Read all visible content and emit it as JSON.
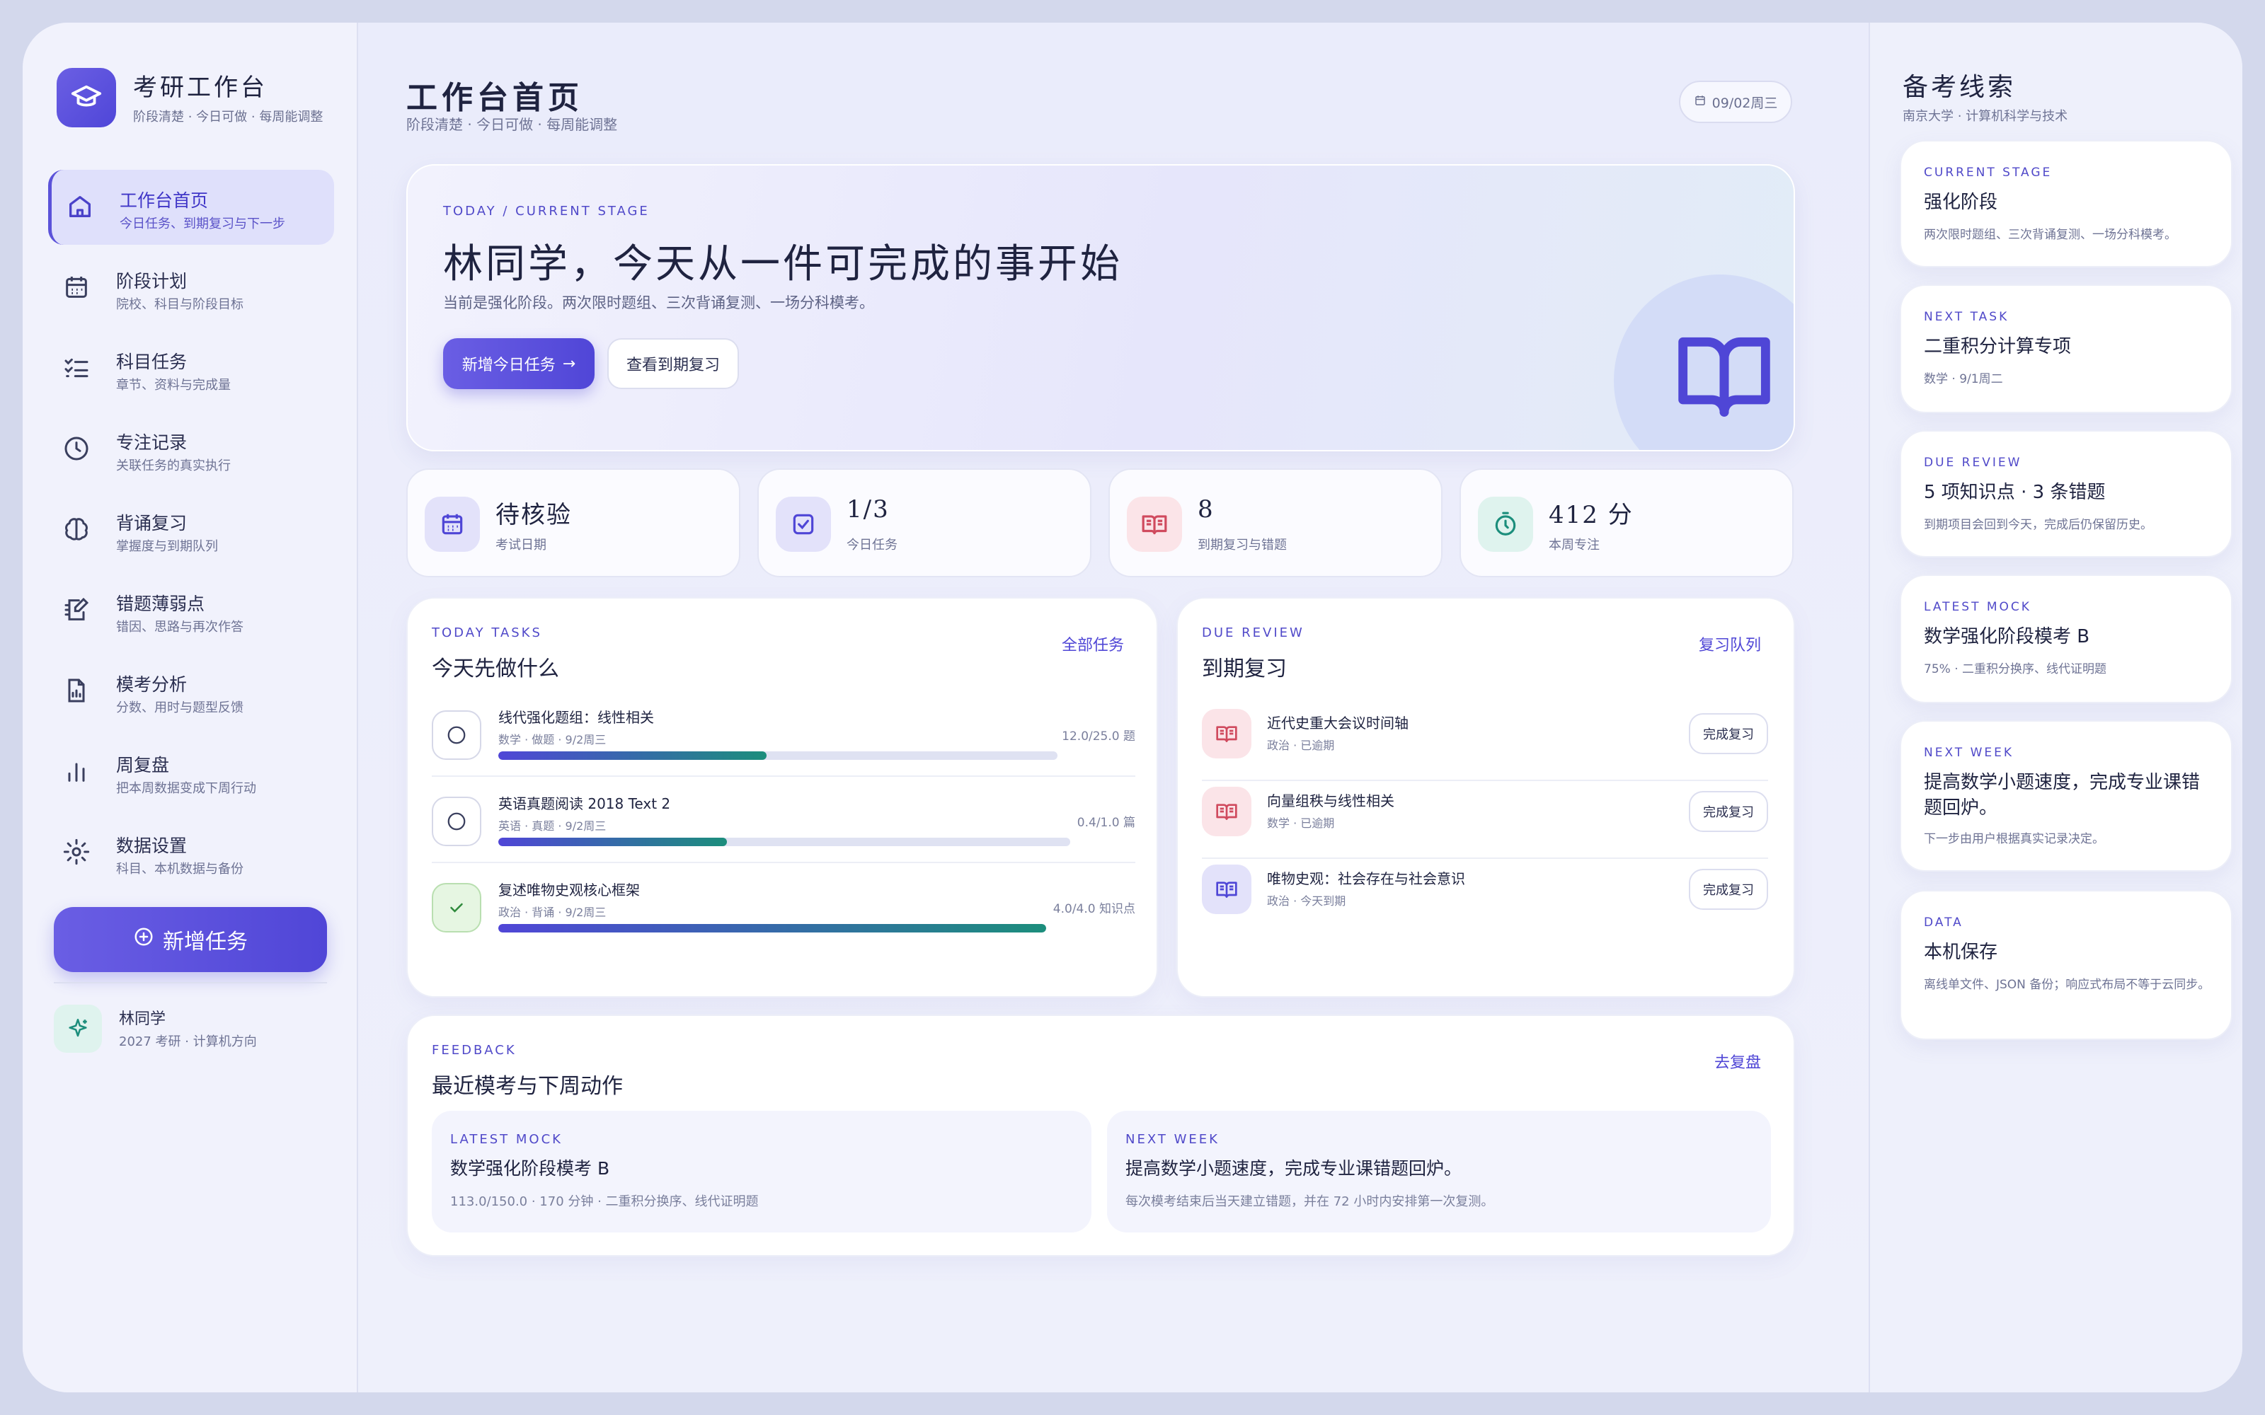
{
  "brand": {
    "title": "考研工作台",
    "subtitle": "阶段清楚 · 今日可做 · 每周能调整"
  },
  "nav": [
    {
      "label": "工作台首页",
      "sub": "今日任务、到期复习与下一步",
      "icon": "home-icon",
      "active": true
    },
    {
      "label": "阶段计划",
      "sub": "院校、科目与阶段目标",
      "icon": "calendar-icon"
    },
    {
      "label": "科目任务",
      "sub": "章节、资料与完成量",
      "icon": "checklist-icon"
    },
    {
      "label": "专注记录",
      "sub": "关联任务的真实执行",
      "icon": "clock-icon"
    },
    {
      "label": "背诵复习",
      "sub": "掌握度与到期队列",
      "icon": "brain-icon"
    },
    {
      "label": "错题薄弱点",
      "sub": "错因、思路与再次作答",
      "icon": "notebook-pen-icon"
    },
    {
      "label": "模考分析",
      "sub": "分数、用时与题型反馈",
      "icon": "file-chart-icon"
    },
    {
      "label": "周复盘",
      "sub": "把本周数据变成下周行动",
      "icon": "bar-chart-icon"
    },
    {
      "label": "数据设置",
      "sub": "科目、本机数据与备份",
      "icon": "gear-icon"
    }
  ],
  "new_task_button": "新增任务",
  "user": {
    "name": "林同学",
    "sub": "2027 考研 · 计算机方向"
  },
  "header": {
    "title": "工作台首页",
    "subtitle": "阶段清楚 · 今日可做 · 每周能调整",
    "date": "09/02周三"
  },
  "hero": {
    "eyebrow": "TODAY / CURRENT STAGE",
    "title": "林同学，今天从一件可完成的事开始",
    "desc": "当前是强化阶段。两次限时题组、三次背诵复测、一场分科模考。",
    "primary_button": "新增今日任务",
    "secondary_button": "查看到期复习"
  },
  "stats": [
    {
      "value": "待核验",
      "label": "考试日期",
      "icon": "calendar-icon"
    },
    {
      "value": "1/3",
      "label": "今日任务",
      "icon": "check-square-icon"
    },
    {
      "value": "8",
      "label": "到期复习与错题",
      "icon": "open-book-icon"
    },
    {
      "value": "412 分",
      "label": "本周专注",
      "icon": "timer-icon"
    }
  ],
  "today_tasks": {
    "eyebrow": "TODAY TASKS",
    "title": "今天先做什么",
    "link": "全部任务",
    "items": [
      {
        "title": "线代强化题组：线性相关",
        "meta": "数学 · 做题 · 9/2周三",
        "progress_text": "12.0/25.0 题",
        "progress": 0.48,
        "done": false
      },
      {
        "title": "英语真题阅读 2018 Text 2",
        "meta": "英语 · 真题 · 9/2周三",
        "progress_text": "0.4/1.0 篇",
        "progress": 0.4,
        "done": false
      },
      {
        "title": "复述唯物史观核心框架",
        "meta": "政治 · 背诵 · 9/2周三",
        "progress_text": "4.0/4.0 知识点",
        "progress": 1.0,
        "done": true
      }
    ]
  },
  "due_review": {
    "eyebrow": "DUE REVIEW",
    "title": "到期复习",
    "link": "复习队列",
    "items": [
      {
        "title": "近代史重大会议时间轴",
        "meta": "政治 · 已逾期",
        "button": "完成复习",
        "tone": "red"
      },
      {
        "title": "向量组秩与线性相关",
        "meta": "数学 · 已逾期",
        "button": "完成复习",
        "tone": "red"
      },
      {
        "title": "唯物史观：社会存在与社会意识",
        "meta": "政治 · 今天到期",
        "button": "完成复习",
        "tone": "purple"
      }
    ]
  },
  "feedback": {
    "eyebrow": "FEEDBACK",
    "title": "最近模考与下周动作",
    "link": "去复盘",
    "mock": {
      "eyebrow": "LATEST MOCK",
      "title": "数学强化阶段模考 B",
      "desc": "113.0/150.0 · 170 分钟 · 二重积分换序、线代证明题"
    },
    "next": {
      "eyebrow": "NEXT WEEK",
      "title": "提高数学小题速度，完成专业课错题回炉。",
      "desc": "每次模考结束后当天建立错题，并在 72 小时内安排第一次复测。"
    }
  },
  "clues": {
    "title": "备考线索",
    "subtitle": "南京大学 · 计算机科学与技术",
    "cards": [
      {
        "eyebrow": "CURRENT STAGE",
        "title": "强化阶段",
        "desc": "两次限时题组、三次背诵复测、一场分科模考。"
      },
      {
        "eyebrow": "NEXT TASK",
        "title": "二重积分计算专项",
        "desc": "数学 · 9/1周二"
      },
      {
        "eyebrow": "DUE REVIEW",
        "title": "5 项知识点 · 3 条错题",
        "desc": "到期项目会回到今天，完成后仍保留历史。"
      },
      {
        "eyebrow": "LATEST MOCK",
        "title": "数学强化阶段模考 B",
        "desc": "75% · 二重积分换序、线代证明题"
      },
      {
        "eyebrow": "NEXT WEEK",
        "title": "提高数学小题速度，完成专业课错题回炉。",
        "desc": "下一步由用户根据真实记录决定。"
      },
      {
        "eyebrow": "DATA",
        "title": "本机保存",
        "desc": "离线单文件、JSON 备份；响应式布局不等于云同步。"
      }
    ]
  },
  "colors": {
    "accent": "#5046d7",
    "progress_end": "#1c8e7c",
    "background": "#eaecfb"
  }
}
